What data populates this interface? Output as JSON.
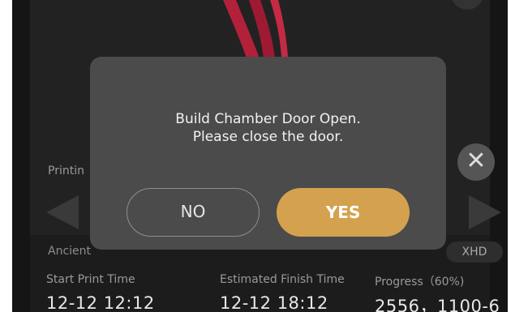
{
  "status": {
    "printing_label": "Printin",
    "material_label": "Ancient",
    "layer_mode_badge": "XHD"
  },
  "info": {
    "start_label": "Start Print Time",
    "start_value": "12-12 12:12",
    "estimated_label": "Estimated Finish Time",
    "estimated_value": "12-12 18:12",
    "progress_label": "Progress（60%)",
    "progress_value": "2556，1100-6"
  },
  "dialog": {
    "line1": "Build Chamber Door Open.",
    "line2": "Please close the door.",
    "no_label": "NO",
    "yes_label": "YES"
  },
  "icons": {
    "close": "close-icon",
    "prev": "prev-arrow-icon",
    "next": "next-arrow-icon"
  },
  "colors": {
    "accent": "#d4a24e",
    "model": "#b3203a",
    "background": "#1c1c1c",
    "dialog": "#4b4b4b"
  }
}
